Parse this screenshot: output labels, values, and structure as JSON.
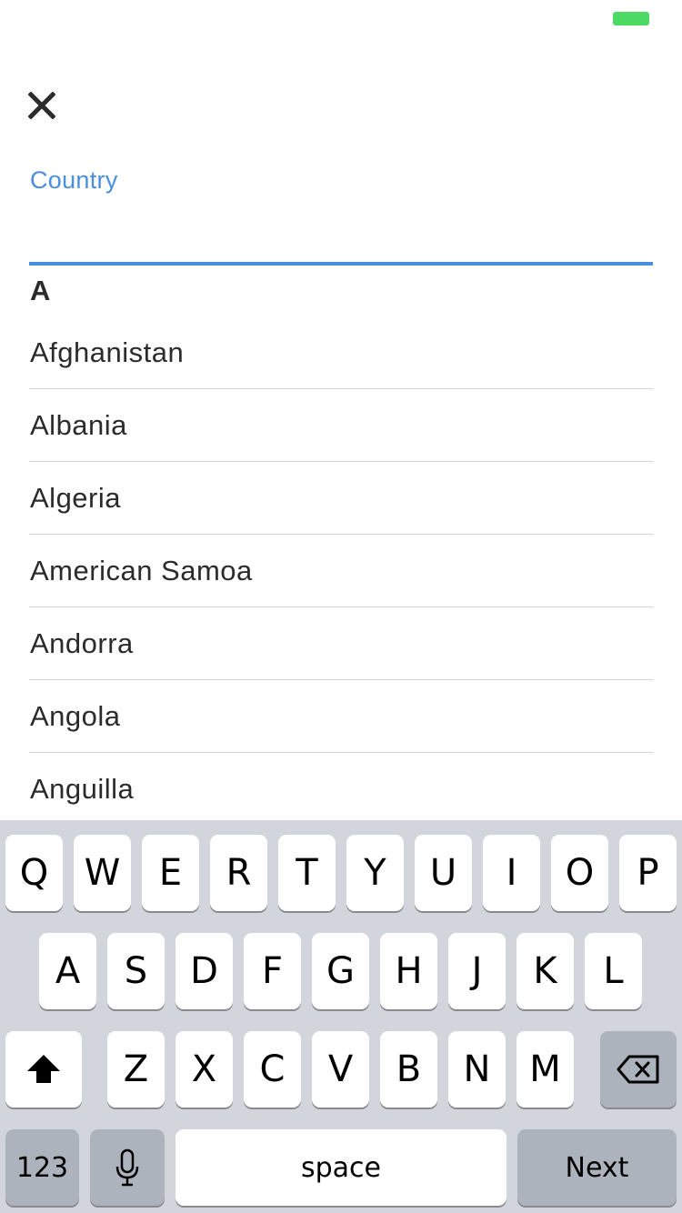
{
  "status_bar": {
    "battery_color": "#4cd964"
  },
  "header": {
    "close_icon": "close-icon"
  },
  "field": {
    "label": "Country",
    "value": "",
    "accent_color": "#4a8ee0"
  },
  "list": {
    "section": "A",
    "countries": [
      "Afghanistan",
      "Albania",
      "Algeria",
      "American Samoa",
      "Andorra",
      "Angola",
      "Anguilla"
    ]
  },
  "keyboard": {
    "row1": [
      "Q",
      "W",
      "E",
      "R",
      "T",
      "Y",
      "U",
      "I",
      "O",
      "P"
    ],
    "row2": [
      "A",
      "S",
      "D",
      "F",
      "G",
      "H",
      "J",
      "K",
      "L"
    ],
    "row3": [
      "Z",
      "X",
      "C",
      "V",
      "B",
      "N",
      "M"
    ],
    "numbers_label": "123",
    "space_label": "space",
    "next_label": "Next",
    "shift_icon": "shift-icon",
    "mic_icon": "microphone-icon",
    "delete_icon": "backspace-icon"
  }
}
